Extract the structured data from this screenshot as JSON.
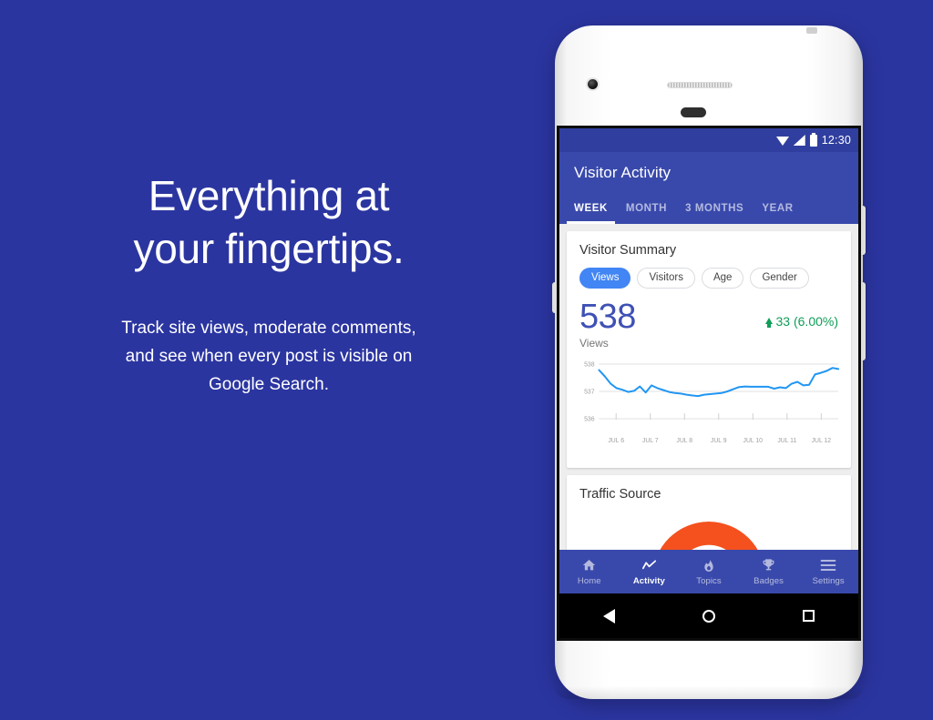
{
  "promo": {
    "headline_line1": "Everything at",
    "headline_line2": "your fingertips.",
    "sub_line1": "Track site views, moderate comments,",
    "sub_line2": "and see when every post is visible on",
    "sub_line3": "Google Search."
  },
  "colors": {
    "page_background": "#2B35A0",
    "app_bar": "#3949AB",
    "status_bar": "#303F9F",
    "accent_chip": "#4285F4",
    "metric": "#3F51B5",
    "positive": "#0F9D58",
    "chart_line": "#2196F3",
    "donut_primary": "#F4511E"
  },
  "status_bar": {
    "time": "12:30",
    "icons": [
      "wifi-icon",
      "signal-icon",
      "battery-icon"
    ]
  },
  "app_bar": {
    "title": "Visitor Activity",
    "tabs": [
      {
        "label": "WEEK",
        "active": true
      },
      {
        "label": "MONTH",
        "active": false
      },
      {
        "label": "3 MONTHS",
        "active": false
      },
      {
        "label": "YEAR",
        "active": false
      }
    ]
  },
  "visitor_summary": {
    "title": "Visitor Summary",
    "chips": [
      {
        "label": "Views",
        "selected": true
      },
      {
        "label": "Visitors",
        "selected": false
      },
      {
        "label": "Age",
        "selected": false
      },
      {
        "label": "Gender",
        "selected": false
      }
    ],
    "metric_value": "538",
    "metric_label": "Views",
    "delta_text": "33 (6.00%)",
    "delta_direction": "up"
  },
  "traffic_source": {
    "title": "Traffic Source"
  },
  "bottom_nav": [
    {
      "label": "Home",
      "icon": "home-icon",
      "active": false
    },
    {
      "label": "Activity",
      "icon": "activity-chart-icon",
      "active": true
    },
    {
      "label": "Topics",
      "icon": "flame-icon",
      "active": false
    },
    {
      "label": "Badges",
      "icon": "trophy-icon",
      "active": false
    },
    {
      "label": "Settings",
      "icon": "hamburger-menu-icon",
      "active": false
    }
  ],
  "android_nav": [
    {
      "name": "back-button",
      "icon": "triangle-back-icon"
    },
    {
      "name": "home-button",
      "icon": "circle-home-icon"
    },
    {
      "name": "recents-button",
      "icon": "square-recents-icon"
    }
  ],
  "chart_data": {
    "type": "line",
    "title": "Views",
    "xlabel": "",
    "ylabel": "",
    "grid": true,
    "legend": false,
    "ylim": [
      536,
      538
    ],
    "yticks": [
      "536",
      "537",
      "538"
    ],
    "categories": [
      "JUL 6",
      "JUL 7",
      "JUL 8",
      "JUL 9",
      "JUL 10",
      "JUL 11",
      "JUL 12"
    ],
    "x": [
      0,
      1,
      2,
      3,
      4,
      5,
      6,
      7,
      8,
      9,
      10,
      11,
      12,
      13,
      14,
      15,
      16,
      17,
      18,
      19,
      20,
      21,
      22,
      23,
      24,
      25,
      26,
      27,
      28,
      29,
      30,
      31,
      32,
      33,
      34,
      35,
      36,
      37,
      38,
      39,
      40,
      41
    ],
    "values": [
      537.78,
      537.55,
      537.28,
      537.12,
      537.06,
      536.98,
      537.02,
      537.18,
      536.96,
      537.22,
      537.12,
      537.05,
      536.98,
      536.94,
      536.92,
      536.88,
      536.85,
      536.83,
      536.88,
      536.9,
      536.92,
      536.94,
      537.0,
      537.08,
      537.16,
      537.18,
      537.17,
      537.17,
      537.17,
      537.17,
      537.1,
      537.15,
      537.12,
      537.28,
      537.35,
      537.22,
      537.24,
      537.62,
      537.68,
      537.75,
      537.86,
      537.82
    ],
    "line_color": "#2196F3"
  }
}
